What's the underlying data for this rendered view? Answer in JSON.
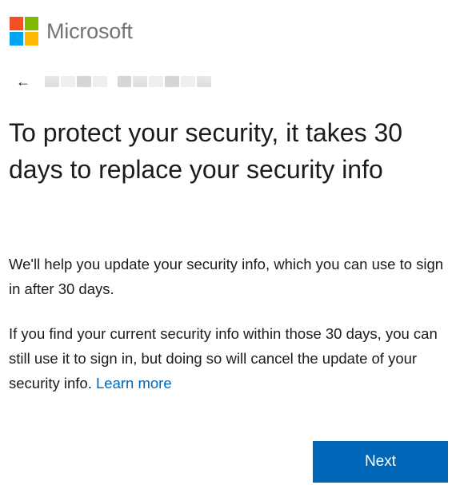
{
  "brand": {
    "name": "Microsoft",
    "logo_colors": [
      "#f25022",
      "#7fba00",
      "#00a4ef",
      "#ffb900"
    ]
  },
  "identity": {
    "back_icon": "back-arrow-icon",
    "back_glyph": "←"
  },
  "title": "To protect your security, it takes 30 days to replace your security info",
  "paragraphs": {
    "p1": "We'll help you update your security info, which you can use to sign in after 30 days.",
    "p2_text": "If you find your current security info within those 30 days, you can still use it to sign in, but doing so will cancel the update of your security info.",
    "learn_more": "Learn more"
  },
  "actions": {
    "next_label": "Next"
  },
  "colors": {
    "accent": "#0067b8",
    "text": "#1b1b1b",
    "brand_gray": "#737373"
  }
}
